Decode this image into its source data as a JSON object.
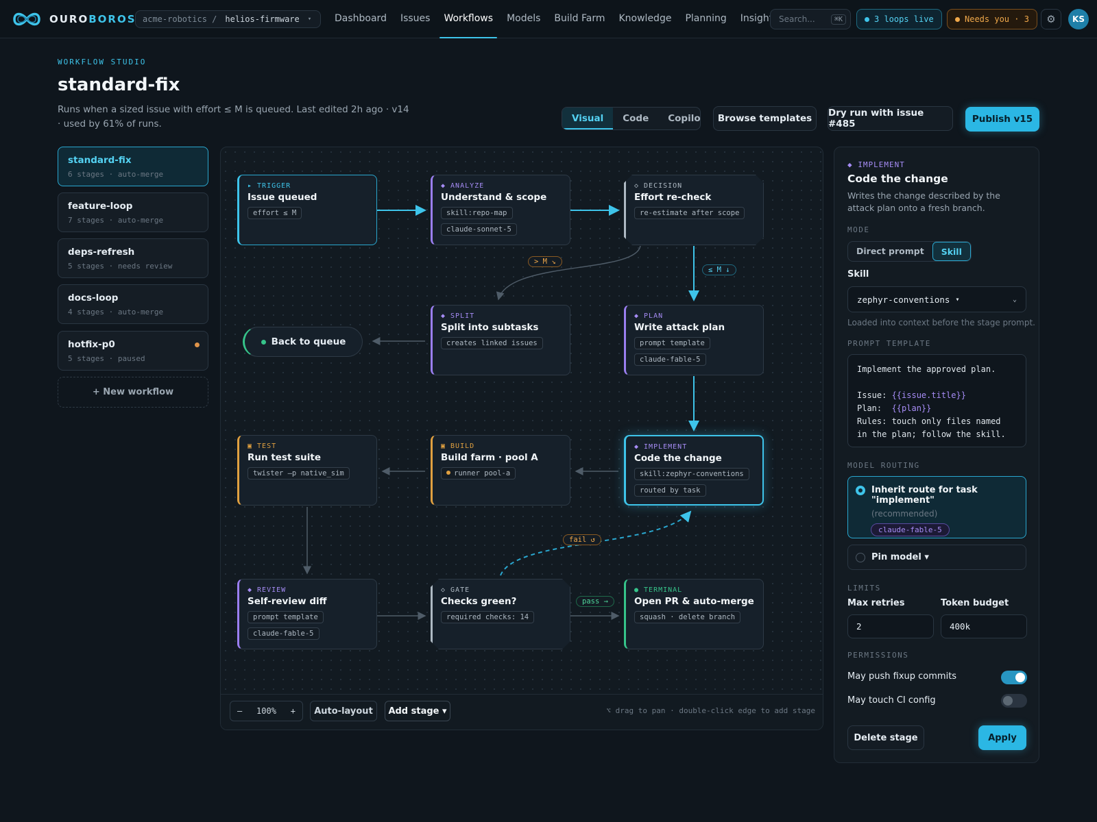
{
  "brand": {
    "part1": "OURO",
    "part2": "BOROS"
  },
  "repo": {
    "org": "acme-robotics /",
    "name": "helios-firmware"
  },
  "nav": [
    "Dashboard",
    "Issues",
    "Workflows",
    "Models",
    "Build Farm",
    "Knowledge",
    "Planning",
    "Insights"
  ],
  "nav_active": "Workflows",
  "search": {
    "placeholder": "Search...",
    "shortcut": "⌘K"
  },
  "status": {
    "loops": "3 loops live",
    "needs": "Needs you · 3"
  },
  "user": {
    "initials": "KS"
  },
  "header": {
    "eyebrow": "WORKFLOW STUDIO",
    "title": "standard-fix",
    "subtitle": "Runs when a sized issue with effort ≤ M is queued. Last edited 2h ago · v14 · used by 61% of runs."
  },
  "view_tabs": [
    "Visual",
    "Code",
    "Copilot"
  ],
  "actions": {
    "browse": "Browse templates",
    "dry_run": "Dry run with issue #485",
    "publish": "Publish v15"
  },
  "workflows": [
    {
      "name": "standard-fix",
      "meta": "6 stages · auto-merge"
    },
    {
      "name": "feature-loop",
      "meta": "7 stages · auto-merge"
    },
    {
      "name": "deps-refresh",
      "meta": "5 stages · needs review"
    },
    {
      "name": "docs-loop",
      "meta": "4 stages · auto-merge"
    },
    {
      "name": "hotfix-p0",
      "meta": "5 stages · paused"
    }
  ],
  "new_workflow": "+ New workflow",
  "nodes": {
    "trigger": {
      "kind": "▸ TRIGGER",
      "title": "Issue queued",
      "tags": [
        "effort ≤ M"
      ]
    },
    "analyze": {
      "kind": "◆ ANALYZE",
      "title": "Understand & scope",
      "tags": [
        "skill:repo-map",
        "claude-sonnet-5"
      ]
    },
    "decision": {
      "kind": "◇ DECISION",
      "title": "Effort re-check",
      "tags": [
        "re-estimate after scope"
      ]
    },
    "split": {
      "kind": "◆ SPLIT",
      "title": "Split into subtasks",
      "tags": [
        "creates linked issues"
      ]
    },
    "plan": {
      "kind": "◆ PLAN",
      "title": "Write attack plan",
      "tags": [
        "prompt template",
        "claude-fable-5"
      ]
    },
    "test": {
      "kind": "▣ TEST",
      "title": "Run test suite",
      "tags": [
        "twister –p native_sim"
      ]
    },
    "build": {
      "kind": "▣ BUILD",
      "title": "Build farm · pool A",
      "tags": [
        "runner pool-a"
      ]
    },
    "implement": {
      "kind": "◆ IMPLEMENT",
      "title": "Code the change",
      "tags": [
        "skill:zephyr-conventions",
        "routed by task"
      ]
    },
    "review": {
      "kind": "◆ REVIEW",
      "title": "Self-review diff",
      "tags": [
        "prompt template",
        "claude-fable-5"
      ]
    },
    "gate": {
      "kind": "◇ GATE",
      "title": "Checks green?",
      "tags": [
        "required checks: 14"
      ]
    },
    "terminal": {
      "kind": "● TERMINAL",
      "title": "Open PR & auto-merge",
      "tags": [
        "squash · delete branch"
      ]
    },
    "queue": {
      "title": "Back to queue"
    }
  },
  "edge_labels": {
    "gt_m": "> M ↘",
    "le_m": "≤ M ↓",
    "fail": "fail ↺",
    "pass": "pass →"
  },
  "canvas_footer": {
    "zoom_out": "–",
    "zoom": "100%",
    "zoom_in": "+",
    "auto_layout": "Auto-layout",
    "add_stage": "Add stage ▾",
    "hint": "⌥ drag to pan · double-click edge to add stage"
  },
  "inspector": {
    "kind": "◆ IMPLEMENT",
    "title": "Code the change",
    "desc": "Writes the change described by the attack plan onto a fresh branch.",
    "mode_label": "MODE",
    "modes": [
      "Direct prompt",
      "Skill"
    ],
    "skill_label": "Skill",
    "skill_value": "zephyr-conventions",
    "skill_help": "Loaded into context before the stage prompt.",
    "prompt_label": "PROMPT TEMPLATE",
    "prompt_lines": [
      "Implement the approved plan.",
      "",
      "Issue: ",
      "Plan:  ",
      "Rules: touch only files named",
      "in the plan; follow the skill."
    ],
    "prompt_vars": [
      "{{issue.title}}",
      "{{plan}}"
    ],
    "routing_label": "MODEL ROUTING",
    "route_inherit": "Inherit route for task \"implement\"",
    "route_rec": "(recommended)",
    "route_model": "claude-fable-5",
    "route_pin": "Pin model ▾",
    "limits_label": "LIMITS",
    "retries_label": "Max retries",
    "retries": "2",
    "budget_label": "Token budget",
    "budget": "400k",
    "perms_label": "PERMISSIONS",
    "perm1": "May push fixup commits",
    "perm1_on": true,
    "perm2": "May touch CI config",
    "perm2_on": false,
    "delete": "Delete stage",
    "apply": "Apply"
  },
  "colors": {
    "accent": "#3ec4ea",
    "purple": "#a68cf5",
    "amber": "#e0a040",
    "green": "#36c48a"
  }
}
